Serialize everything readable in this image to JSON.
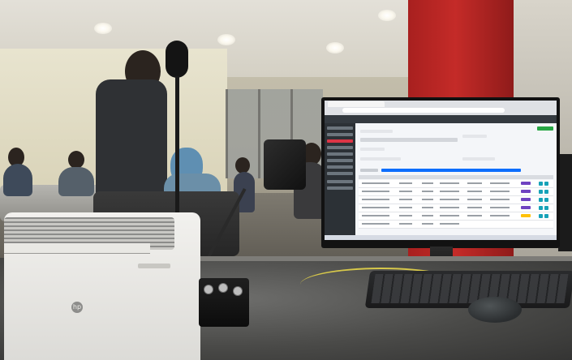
{
  "scene": {
    "description_objects": [
      "printer-icon",
      "microphone-icon",
      "speaker-icon",
      "monitor-icon",
      "keyboard-icon",
      "mouse-icon"
    ],
    "colors": {
      "pillar": "#c42b28",
      "app_sidebar": "#2c3136",
      "app_accent_active": "#dc3545",
      "app_primary": "#0d6efd",
      "app_success": "#28a745"
    }
  }
}
